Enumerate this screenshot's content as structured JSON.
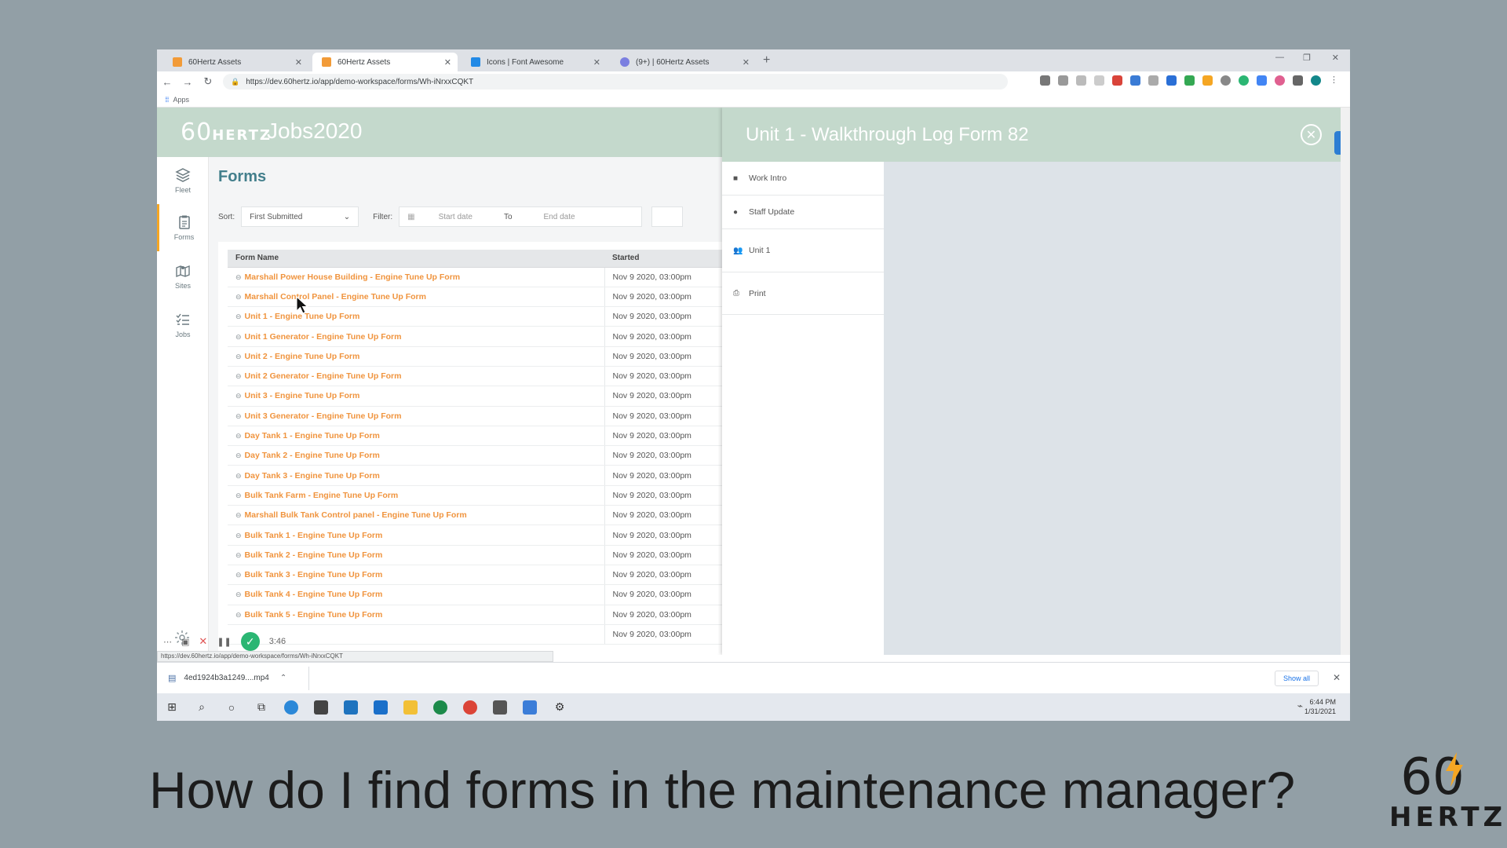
{
  "browser": {
    "tabs": [
      {
        "title": "60Hertz Assets",
        "active": false,
        "color": "#f29b38"
      },
      {
        "title": "60Hertz Assets",
        "active": true,
        "color": "#f29b38"
      },
      {
        "title": "Icons | Font Awesome",
        "active": false,
        "color": "#228ae6"
      },
      {
        "title": "(9+) | 60Hertz Assets",
        "active": false,
        "color": "#7b7fe0"
      }
    ],
    "url": "https://dev.60hertz.io/app/demo-workspace/forms/Wh-iNrxxCQKT",
    "bookmarks_label": "Apps"
  },
  "app": {
    "logo_text": "60",
    "logo_small": "HERTZ",
    "workspace_name": "Jobs2020",
    "nav": [
      {
        "label": "Fleet",
        "icon": "layers-icon",
        "active": false
      },
      {
        "label": "Forms",
        "icon": "clipboard-icon",
        "active": true
      },
      {
        "label": "Sites",
        "icon": "map-icon",
        "active": false
      },
      {
        "label": "Jobs",
        "icon": "checklist-icon",
        "active": false
      }
    ],
    "page_title": "Forms",
    "sort": {
      "label": "Sort:",
      "value": "First Submitted"
    },
    "filter": {
      "label": "Filter:",
      "start_placeholder": "Start date",
      "to_label": "To",
      "end_placeholder": "End date"
    },
    "table": {
      "columns": [
        "Form Name",
        "Started"
      ],
      "rows": [
        {
          "name": "Marshall Power House Building - Engine Tune Up Form",
          "started": "Nov 9 2020, 03:00pm"
        },
        {
          "name": "Marshall Control Panel - Engine Tune Up Form",
          "started": "Nov 9 2020, 03:00pm"
        },
        {
          "name": "Unit 1 - Engine Tune Up Form",
          "started": "Nov 9 2020, 03:00pm"
        },
        {
          "name": "Unit 1 Generator - Engine Tune Up Form",
          "started": "Nov 9 2020, 03:00pm"
        },
        {
          "name": "Unit 2 - Engine Tune Up Form",
          "started": "Nov 9 2020, 03:00pm"
        },
        {
          "name": "Unit 2 Generator - Engine Tune Up Form",
          "started": "Nov 9 2020, 03:00pm"
        },
        {
          "name": "Unit 3 - Engine Tune Up Form",
          "started": "Nov 9 2020, 03:00pm"
        },
        {
          "name": "Unit 3 Generator - Engine Tune Up Form",
          "started": "Nov 9 2020, 03:00pm"
        },
        {
          "name": "Day Tank 1 - Engine Tune Up Form",
          "started": "Nov 9 2020, 03:00pm"
        },
        {
          "name": "Day Tank 2 - Engine Tune Up Form",
          "started": "Nov 9 2020, 03:00pm"
        },
        {
          "name": "Day Tank 3 - Engine Tune Up Form",
          "started": "Nov 9 2020, 03:00pm"
        },
        {
          "name": "Bulk Tank Farm - Engine Tune Up Form",
          "started": "Nov 9 2020, 03:00pm"
        },
        {
          "name": "Marshall Bulk Tank Control panel - Engine Tune Up Form",
          "started": "Nov 9 2020, 03:00pm"
        },
        {
          "name": "Bulk Tank 1 - Engine Tune Up Form",
          "started": "Nov 9 2020, 03:00pm"
        },
        {
          "name": "Bulk Tank 2 - Engine Tune Up Form",
          "started": "Nov 9 2020, 03:00pm"
        },
        {
          "name": "Bulk Tank 3 - Engine Tune Up Form",
          "started": "Nov 9 2020, 03:00pm"
        },
        {
          "name": "Bulk Tank 4 - Engine Tune Up Form",
          "started": "Nov 9 2020, 03:00pm"
        },
        {
          "name": "Bulk Tank 5 - Engine Tune Up Form",
          "started": "Nov 9 2020, 03:00pm"
        },
        {
          "name": "",
          "started": "Nov 9 2020, 03:00pm"
        }
      ]
    }
  },
  "drawer": {
    "title": "Unit 1 - Walkthrough Log Form 82",
    "menu": [
      {
        "label": "Work Intro",
        "icon": "book-icon"
      },
      {
        "label": "Staff Update",
        "icon": "dot-icon"
      },
      {
        "label": "Unit 1",
        "icon": "users-icon"
      },
      {
        "label": "Print",
        "icon": "printer-icon"
      }
    ]
  },
  "overlay": {
    "status_url": "https://dev.60hertz.io/app/demo-workspace/forms/Wh-iNrxxCQKT",
    "recorder_time": "3:46"
  },
  "download": {
    "file": "4ed1924b3a1249....mp4",
    "show_all": "Show all"
  },
  "taskbar": {
    "time": "6:44 PM",
    "date": "1/31/2021"
  },
  "caption": "How do I find forms in the maintenance manager?",
  "brand": {
    "num": "60",
    "word": "HERTZ"
  },
  "colors": {
    "accent_orange": "#f0943e",
    "header_green": "#c4d9cc",
    "title_teal": "#437f8c"
  }
}
